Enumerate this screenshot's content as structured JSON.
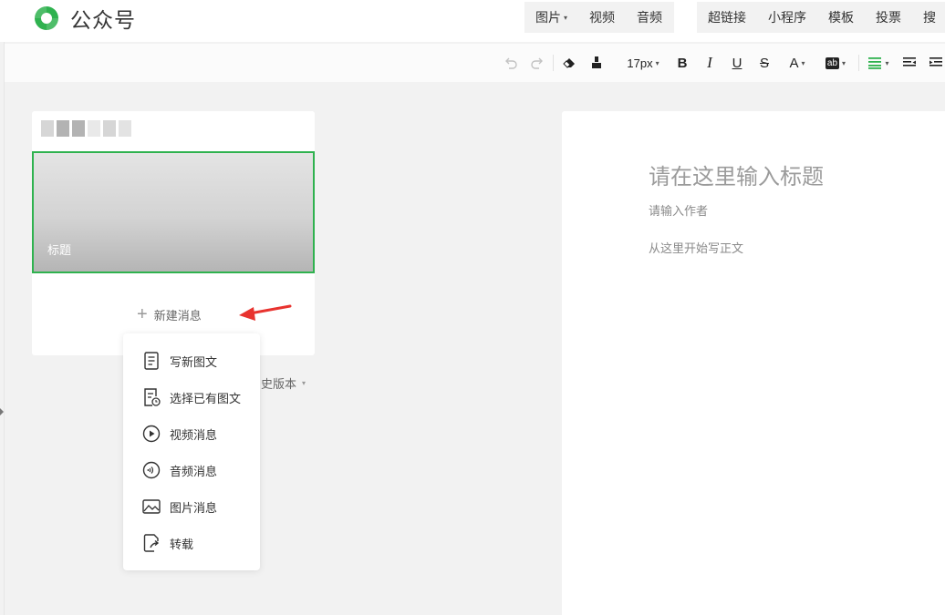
{
  "app": {
    "logo_text": "公众号"
  },
  "header": {
    "group1": [
      {
        "label": "图片",
        "caret": "▾"
      },
      {
        "label": "视频"
      },
      {
        "label": "音频"
      }
    ],
    "group2": [
      {
        "label": "超链接"
      },
      {
        "label": "小程序"
      },
      {
        "label": "模板"
      },
      {
        "label": "投票"
      },
      {
        "label": "搜"
      }
    ]
  },
  "toolbar": {
    "font_size": "17px",
    "font_size_caret": "▾",
    "color_caret": "▾",
    "bg_caret": "▾",
    "align_caret": "▾",
    "icons": [
      "undo-icon",
      "redo-icon",
      "eraser-icon",
      "format-brush-icon",
      "bold-icon",
      "italic-icon",
      "underline-icon",
      "strikethrough-icon",
      "font-color-icon",
      "background-color-icon",
      "align-icon",
      "indent-icon",
      "outdent-icon"
    ],
    "accent_color": "#2fb24f"
  },
  "article_list": {
    "cover_title": "标题",
    "new_message": "新建消息",
    "history_partial": "史版本",
    "history_caret": "▾"
  },
  "new_menu": {
    "items": [
      {
        "label": "写新图文",
        "icon": "article-icon"
      },
      {
        "label": "选择已有图文",
        "icon": "existing-article-icon"
      },
      {
        "label": "视频消息",
        "icon": "video-play-icon"
      },
      {
        "label": "音频消息",
        "icon": "audio-icon"
      },
      {
        "label": "图片消息",
        "icon": "image-icon"
      },
      {
        "label": "转载",
        "icon": "repost-icon"
      }
    ]
  },
  "editor": {
    "title_placeholder": "请在这里输入标题",
    "author_placeholder": "请输入作者",
    "body_placeholder": "从这里开始写正文"
  },
  "colors": {
    "brand_green": "#2fb24f",
    "arrow_red": "#e8332f"
  }
}
